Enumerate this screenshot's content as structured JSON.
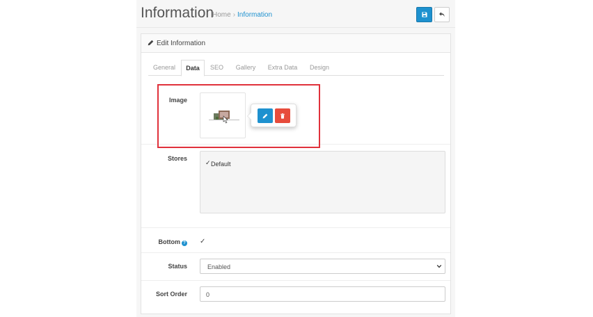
{
  "header": {
    "title": "Information",
    "breadcrumb": {
      "home": "Home",
      "separator": "›",
      "current": "Information"
    },
    "buttons": {
      "save_icon": "save-icon",
      "back_icon": "reply-icon"
    }
  },
  "panel": {
    "title": "Edit Information",
    "tabs": [
      {
        "label": "General",
        "active": false
      },
      {
        "label": "Data",
        "active": true
      },
      {
        "label": "SEO",
        "active": false
      },
      {
        "label": "Gallery",
        "active": false
      },
      {
        "label": "Extra Data",
        "active": false
      },
      {
        "label": "Design",
        "active": false
      }
    ]
  },
  "form": {
    "image": {
      "label": "Image",
      "popover": {
        "edit_icon": "pencil-icon",
        "delete_icon": "trash-icon"
      }
    },
    "stores": {
      "label": "Stores",
      "items": [
        {
          "label": "Default",
          "checked": true
        }
      ]
    },
    "bottom": {
      "label": "Bottom",
      "checked": true
    },
    "status": {
      "label": "Status",
      "value": "Enabled"
    },
    "sort_order": {
      "label": "Sort Order",
      "value": "0"
    }
  },
  "colors": {
    "primary": "#1e91cf",
    "danger": "#e74c3c",
    "highlight": "#e0313b"
  }
}
